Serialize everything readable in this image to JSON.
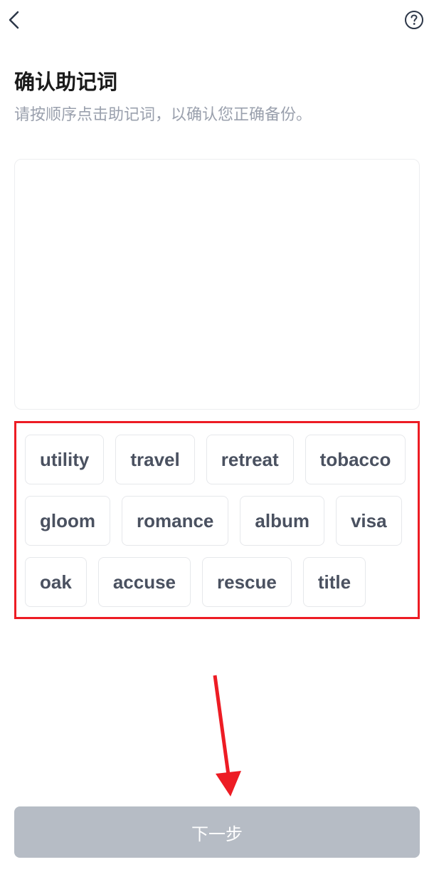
{
  "header": {
    "back_label": "返回",
    "help_label": "帮助"
  },
  "page": {
    "title": "确认助记词",
    "subtitle": "请按顺序点击助记词，以确认您正确备份。"
  },
  "words": [
    "utility",
    "travel",
    "retreat",
    "tobacco",
    "gloom",
    "romance",
    "album",
    "visa",
    "oak",
    "accuse",
    "rescue",
    "title"
  ],
  "footer": {
    "next_label": "下一步"
  },
  "colors": {
    "highlight_border": "#ed1c24",
    "text_primary": "#1a1a1a",
    "text_secondary": "#9aa0ad",
    "chip_text": "#4a5160",
    "button_bg": "#b6bcc5"
  }
}
